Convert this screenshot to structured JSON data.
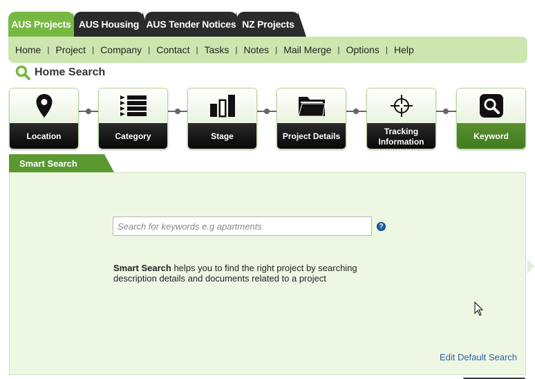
{
  "tabs": [
    {
      "label": "AUS Projects",
      "active": true
    },
    {
      "label": "AUS Housing",
      "active": false
    },
    {
      "label": "AUS Tender Notices",
      "active": false
    },
    {
      "label": "NZ Projects",
      "active": false
    }
  ],
  "menu": [
    "Home",
    "Project",
    "Company",
    "Contact",
    "Tasks",
    "Notes",
    "Mail Merge",
    "Options",
    "Help"
  ],
  "menu_separator": "|",
  "page_title": "Home Search",
  "steps": [
    {
      "label": "Location",
      "icon": "location-pin-icon"
    },
    {
      "label": "Category",
      "icon": "list-icon"
    },
    {
      "label": "Stage",
      "icon": "bar-stages-icon"
    },
    {
      "label": "Project Details",
      "icon": "folder-icon"
    },
    {
      "label": "Tracking Information",
      "icon": "crosshair-icon"
    },
    {
      "label": "Keyword",
      "icon": "magnifier-icon",
      "active": true
    }
  ],
  "smart_search": {
    "tab_label": "Smart Search",
    "placeholder": "Search for keywords e.g apartments",
    "help_glyph": "?",
    "desc_bold": "Smart Search",
    "desc_rest": " helps you to find the right project by searching description details and documents related to a project",
    "edit_link": "Edit Default Search"
  },
  "colors": {
    "accent": "#77b843",
    "dark": "#2b2b2b",
    "menu_bg": "#cde6b0",
    "panel_bg": "#eef7e4",
    "link": "#2b5f9e"
  }
}
